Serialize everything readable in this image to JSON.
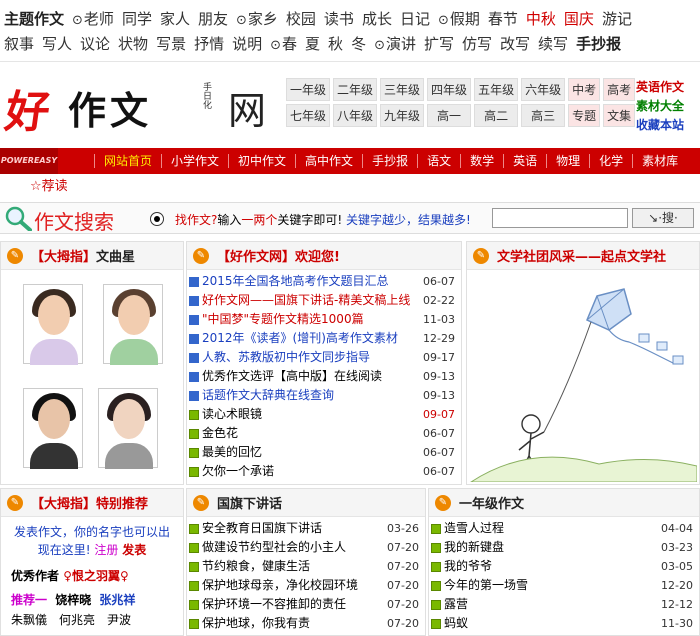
{
  "topics": {
    "row1": [
      {
        "text": "主题作文",
        "style": "b"
      },
      {
        "text": "老师",
        "dot": true
      },
      {
        "text": "同学"
      },
      {
        "text": "家人"
      },
      {
        "text": "朋友"
      },
      {
        "text": "家乡",
        "dot": true
      },
      {
        "text": "校园"
      },
      {
        "text": "读书"
      },
      {
        "text": "成长"
      },
      {
        "text": "日记"
      },
      {
        "text": "假期",
        "dot": true
      },
      {
        "text": "春节"
      },
      {
        "text": "中秋",
        "style": "r"
      },
      {
        "text": "国庆",
        "style": "r"
      },
      {
        "text": "游记"
      }
    ],
    "row2": [
      {
        "text": "叙事"
      },
      {
        "text": "写人"
      },
      {
        "text": "议论"
      },
      {
        "text": "状物"
      },
      {
        "text": "写景"
      },
      {
        "text": "抒情"
      },
      {
        "text": "说明"
      },
      {
        "text": "春",
        "dot": true
      },
      {
        "text": "夏"
      },
      {
        "text": "秋"
      },
      {
        "text": "冬"
      },
      {
        "text": "演讲",
        "dot": true
      },
      {
        "text": "扩写"
      },
      {
        "text": "仿写"
      },
      {
        "text": "改写"
      },
      {
        "text": "续写"
      },
      {
        "text": "手抄报",
        "style": "b"
      }
    ]
  },
  "logo": {
    "hao": "好",
    "zuowen": "作文",
    "seal": "手日化",
    "wang": "网"
  },
  "grades": [
    "一年级",
    "二年级",
    "三年级",
    "四年级",
    "五年级",
    "六年级",
    "中考",
    "高考",
    "七年级",
    "八年级",
    "九年级",
    "高一",
    "高二",
    "高三",
    "专题",
    "文集"
  ],
  "header_links": [
    {
      "text": "英语作文",
      "color": "#cc0000"
    },
    {
      "text": "素材大全",
      "color": "#008000"
    },
    {
      "text": "收藏本站",
      "color": "#1a3fbf"
    }
  ],
  "nav": {
    "brand": "POWEREASY",
    "items": [
      "网站首页",
      "小学作文",
      "初中作文",
      "高中作文",
      "手抄报",
      "语文",
      "数学",
      "英语",
      "物理",
      "化学",
      "素材库"
    ],
    "sub": "☆荐读"
  },
  "search": {
    "title": "作文搜索",
    "prompt_q": "找作文?",
    "prompt_1": "输入",
    "prompt_2": "一两个",
    "prompt_3": "关键字即可!",
    "prompt_4": "关键字越少，结果越多!",
    "button": "↘·搜·"
  },
  "box1": {
    "prefix": "【大拇指】",
    "title": "文曲星",
    "watermark": "www.haozuowen.net"
  },
  "box2": {
    "prefix": "【好作文网】",
    "title": "欢迎您!",
    "items": [
      {
        "text": "2015年全国各地高考作文题目汇总",
        "date": "06-07",
        "color": "blue",
        "icon": "blue"
      },
      {
        "text": "好作文网——国旗下讲话-精美文稿上线",
        "date": "02-22",
        "color": "red",
        "icon": "blue"
      },
      {
        "text": "\"中国梦\"专题作文精选1000篇",
        "date": "11-03",
        "color": "red",
        "icon": "blue"
      },
      {
        "text": "2012年《读者》(增刊)高考作文素材",
        "date": "12-29",
        "color": "blue",
        "icon": "blue"
      },
      {
        "text": "人教、苏教版初中作文同步指导",
        "date": "09-17",
        "color": "blue",
        "icon": "blue"
      },
      {
        "text": "优秀作文选评【高中版】在线阅读",
        "date": "09-13",
        "color": "",
        "icon": "blue"
      },
      {
        "text": "话题作文大辞典在线查询",
        "date": "09-13",
        "color": "blue",
        "icon": "blue"
      },
      {
        "text": "读心术眼镜",
        "date": "09-07",
        "color": "",
        "icon": "grn",
        "datecolor": "red"
      },
      {
        "text": "金色花",
        "date": "06-07",
        "color": "",
        "icon": "grn"
      },
      {
        "text": "最美的回忆",
        "date": "06-07",
        "color": "",
        "icon": "grn"
      },
      {
        "text": "欠你一个承诺",
        "date": "06-07",
        "color": "",
        "icon": "grn"
      }
    ]
  },
  "box3": {
    "title": "文学社团风采——起点文学社",
    "watermark": "www.haozuowen.net"
  },
  "box4": {
    "prefix": "【大拇指】",
    "title": "特别推荐",
    "line1": "发表作文，你的名字也可以出现在这里!",
    "reg": "注册",
    "pub": "发表",
    "author_label": "优秀作者",
    "author_name": "♀恨之羽翼♀",
    "rec_label": "推荐一",
    "rec_1": "饶梓晓",
    "rec_2": "张兆祥",
    "names": [
      "朱飘儀",
      "何兆亮",
      "尹波"
    ]
  },
  "box5": {
    "title": "国旗下讲话",
    "items": [
      {
        "text": "安全教育日国旗下讲话",
        "date": "03-26"
      },
      {
        "text": "做建设节约型社会的小主人",
        "date": "07-20"
      },
      {
        "text": "节约粮食，健康生活",
        "date": "07-20"
      },
      {
        "text": "保护地球母亲，净化校园环境",
        "date": "07-20"
      },
      {
        "text": "保护环境一不容推卸的责任",
        "date": "07-20"
      },
      {
        "text": "保护地球，你我有责",
        "date": "07-20"
      }
    ]
  },
  "box6": {
    "title": "一年级作文",
    "items": [
      {
        "text": "造雪人过程",
        "date": "04-04"
      },
      {
        "text": "我的新键盘",
        "date": "03-23"
      },
      {
        "text": "我的爷爷",
        "date": "03-05"
      },
      {
        "text": "今年的第一场雪",
        "date": "12-20"
      },
      {
        "text": "露营",
        "date": "12-12"
      },
      {
        "text": "蚂蚁",
        "date": "11-30"
      }
    ]
  }
}
